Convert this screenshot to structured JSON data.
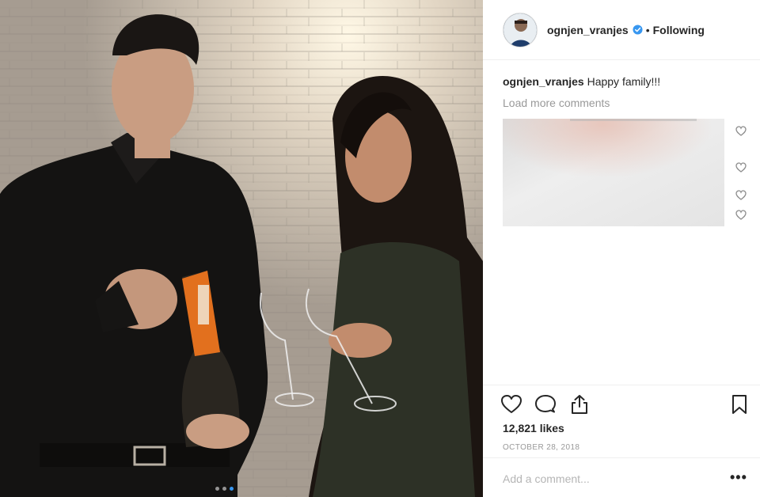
{
  "photo": {
    "carousel_dots": 3,
    "active_dot": 2
  },
  "header": {
    "username": "ognjen_vranjes",
    "separator": "•",
    "follow_status": "Following",
    "verified_color": "#3897f0"
  },
  "caption": {
    "username": "ognjen_vranjes",
    "text": " Happy family!!!"
  },
  "comments": {
    "load_more": "Load more comments"
  },
  "actions": {
    "like_icon": "heart-icon",
    "comment_icon": "comment-icon",
    "share_icon": "share-icon",
    "save_icon": "bookmark-icon"
  },
  "likes": {
    "text": "12,821 likes"
  },
  "date": {
    "text": "OCTOBER 28, 2018"
  },
  "add_comment": {
    "placeholder": "Add a comment...",
    "more_label": "•••"
  }
}
